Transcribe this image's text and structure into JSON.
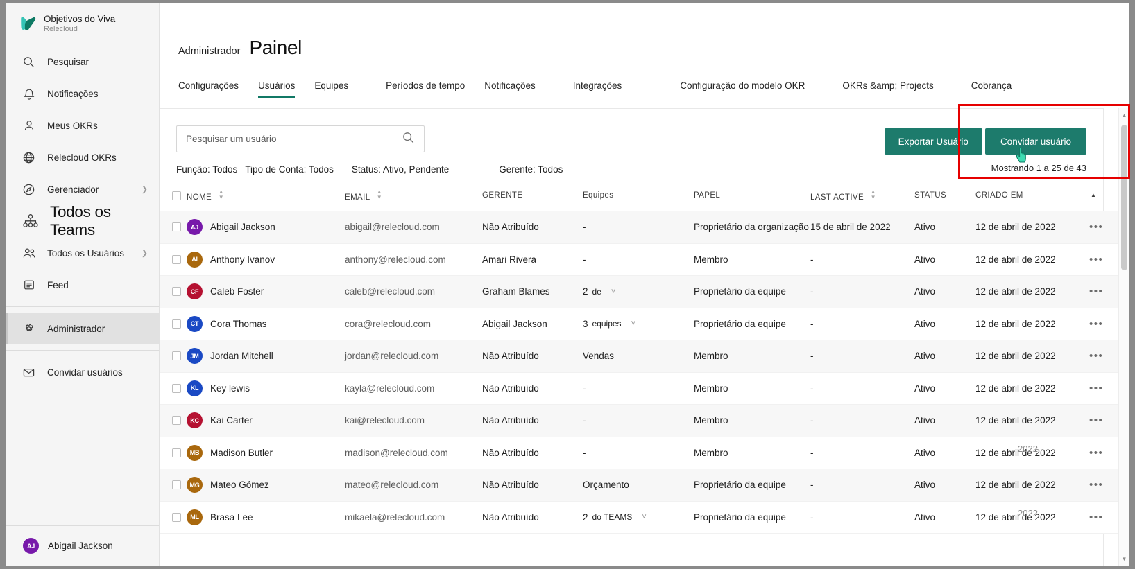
{
  "sidebar": {
    "brand": {
      "title": "Objetivos do Viva",
      "subtitle": "Relecloud",
      "logo_icon": "viva-goals-logo"
    },
    "items": [
      {
        "label": "Pesquisar",
        "icon": "search-icon",
        "name": "pesquisar",
        "chevron": false,
        "big": false,
        "active": false
      },
      {
        "label": "Notificações",
        "icon": "bell-icon",
        "name": "notificacoes",
        "chevron": false,
        "big": false,
        "active": false
      },
      {
        "label": "Meus OKRs",
        "icon": "person-icon",
        "name": "meus-okrs",
        "chevron": false,
        "big": false,
        "active": false
      },
      {
        "label": "Relecloud OKRs",
        "icon": "globe-icon",
        "name": "relecloud-okrs",
        "chevron": false,
        "big": false,
        "active": false
      },
      {
        "label": "Gerenciador",
        "icon": "compass-icon",
        "name": "gerenciador",
        "chevron": true,
        "big": false,
        "active": false
      },
      {
        "label": "Todos os Teams",
        "icon": "org-chart-icon",
        "name": "todos-os-teams",
        "chevron": false,
        "big": true,
        "active": false
      },
      {
        "label": "Todos os Usuários",
        "icon": "people-icon",
        "name": "todos-os-usuarios",
        "chevron": true,
        "big": false,
        "active": false
      },
      {
        "label": "Feed",
        "icon": "feed-icon",
        "name": "feed",
        "chevron": false,
        "big": false,
        "active": false
      },
      {
        "label": "Administrador",
        "icon": "gear-icon",
        "name": "administrador",
        "chevron": false,
        "big": false,
        "active": true
      },
      {
        "label": "Convidar usuários",
        "icon": "envelope-icon",
        "name": "convidar-usuarios",
        "chevron": false,
        "big": false,
        "active": false
      }
    ],
    "profile": {
      "name": "Abigail Jackson",
      "initials": "AJ",
      "color": "#7719aa"
    }
  },
  "header": {
    "breadcrumb": "Administrador",
    "title": "Painel"
  },
  "tabs": [
    {
      "label": "Configurações",
      "active": false
    },
    {
      "label": "Usuários",
      "active": true
    },
    {
      "label": "Equipes",
      "active": false
    },
    {
      "label": "Períodos de tempo",
      "active": false
    },
    {
      "label": "Notificações",
      "active": false
    },
    {
      "label": "Integrações",
      "active": false
    },
    {
      "label": "Configuração do modelo OKR",
      "active": false
    },
    {
      "label": "OKRs &amp; Projects",
      "active": false
    },
    {
      "label": "Cobrança",
      "active": false
    }
  ],
  "toolbar": {
    "search_placeholder": "Pesquisar um usuário",
    "search_value": "",
    "search_icon": "search-icon",
    "filters": [
      {
        "label": "Função: Todos",
        "name": "filter-funcao"
      },
      {
        "label": "Tipo de Conta: Todos",
        "name": "filter-tipo-de-conta"
      },
      {
        "label": "Status: Ativo, Pendente",
        "name": "filter-status"
      },
      {
        "label": "Gerente: Todos",
        "name": "filter-gerente"
      }
    ],
    "export_label": "Exportar Usuário",
    "invite_label": "Convidar usuário",
    "showing": "Mostrando 1 a 25 de 43",
    "button_color": "#1d7b6c"
  },
  "table": {
    "columns": [
      {
        "label": "NOME",
        "sort": "inactive"
      },
      {
        "label": "EMAIL",
        "sort": "inactive"
      },
      {
        "label": "GERENTE",
        "sort": "none"
      },
      {
        "label": "Equipes",
        "sort": "none"
      },
      {
        "label": "PAPEL",
        "sort": "none"
      },
      {
        "label": "LAST ACTIVE",
        "sort": "inactive"
      },
      {
        "label": "STATUS",
        "sort": "none"
      },
      {
        "label": "CRIADO EM",
        "sort": "asc"
      }
    ],
    "rows": [
      {
        "initials": "AJ",
        "color": "#7719aa",
        "name": "Abigail Jackson",
        "email": "abigail@relecloud.com",
        "manager": "Não Atribuído",
        "teams": "-",
        "teams_count": "",
        "teams_label": "",
        "role": "Proprietário da organização",
        "last_active": "15 de abril de 2022",
        "status": "Ativo",
        "created": "12 de abril de 2022",
        "ghost_year": ""
      },
      {
        "initials": "AI",
        "color": "#a9680d",
        "name": "Anthony Ivanov",
        "email": "anthony@relecloud.com",
        "manager": "Amari Rivera",
        "teams": "-",
        "teams_count": "",
        "teams_label": "",
        "role": "Membro",
        "last_active": "-",
        "status": "Ativo",
        "created": "12 de abril de 2022",
        "ghost_year": ""
      },
      {
        "initials": "CF",
        "color": "#b51131",
        "name": "Caleb Foster",
        "email": "caleb@relecloud.com",
        "manager": "Graham Blames",
        "teams": "",
        "teams_count": "2",
        "teams_label": "de",
        "role": "Proprietário da equipe",
        "last_active": "-",
        "status": "Ativo",
        "created": "12 de abril de 2022",
        "ghost_year": ""
      },
      {
        "initials": "CT",
        "color": "#1a49c4",
        "name": "Cora Thomas",
        "email": "cora@relecloud.com",
        "manager": "Abigail Jackson",
        "teams": "",
        "teams_count": "3",
        "teams_label": "equipes",
        "role": "Proprietário da equipe",
        "last_active": "-",
        "status": "Ativo",
        "created": "12 de abril de 2022",
        "ghost_year": ""
      },
      {
        "initials": "JM",
        "color": "#1a49c4",
        "name": "Jordan Mitchell",
        "email": "jordan@relecloud.com",
        "manager": "Não Atribuído",
        "teams": "Vendas",
        "teams_count": "",
        "teams_label": "",
        "role": "Membro",
        "last_active": "-",
        "status": "Ativo",
        "created": "12 de abril de 2022",
        "ghost_year": ""
      },
      {
        "initials": "KL",
        "color": "#1a49c4",
        "name": "Key lewis",
        "email": "kayla@relecloud.com",
        "manager": "Não Atribuído",
        "teams": "-",
        "teams_count": "",
        "teams_label": "",
        "role": "Membro",
        "last_active": "-",
        "status": "Ativo",
        "created": "12 de abril de 2022",
        "ghost_year": ""
      },
      {
        "initials": "KC",
        "color": "#b51131",
        "name": "Kai Carter",
        "email": "kai@relecloud.com",
        "manager": "Não Atribuído",
        "teams": "-",
        "teams_count": "",
        "teams_label": "",
        "role": "Membro",
        "last_active": "-",
        "status": "Ativo",
        "created": "12 de abril de 2022",
        "ghost_year": ""
      },
      {
        "initials": "MB",
        "color": "#a9680d",
        "name": "Madison Butler",
        "email": "madison@relecloud.com",
        "manager": "Não Atribuído",
        "teams": "-",
        "teams_count": "",
        "teams_label": "",
        "role": "Membro",
        "last_active": "-",
        "status": "Ativo",
        "created": "12 de abril de 2022",
        "ghost_year": "2022"
      },
      {
        "initials": "MG",
        "color": "#a9680d",
        "name": "Mateo Gómez",
        "email": "mateo@relecloud.com",
        "manager": "Não Atribuído",
        "teams": "Orçamento",
        "teams_count": "",
        "teams_label": "",
        "role": "Proprietário da equipe",
        "last_active": "-",
        "status": "Ativo",
        "created": "12 de abril de 2022",
        "ghost_year": ""
      },
      {
        "initials": "ML",
        "color": "#a9680d",
        "name": "Brasa Lee",
        "email": "mikaela@relecloud.com",
        "manager": "Não Atribuído",
        "teams": "",
        "teams_count": "2",
        "teams_label": "do TEAMS",
        "role": "Proprietário da equipe",
        "last_active": "-",
        "status": "Ativo",
        "created": "12 de abril de 2022",
        "ghost_year": "2022"
      }
    ],
    "more_label": "•••",
    "chevron_down_icon": "chevron-down-icon"
  },
  "annotation": {
    "color": "#e60000",
    "cursor_icon": "pointer-hand-cursor"
  }
}
